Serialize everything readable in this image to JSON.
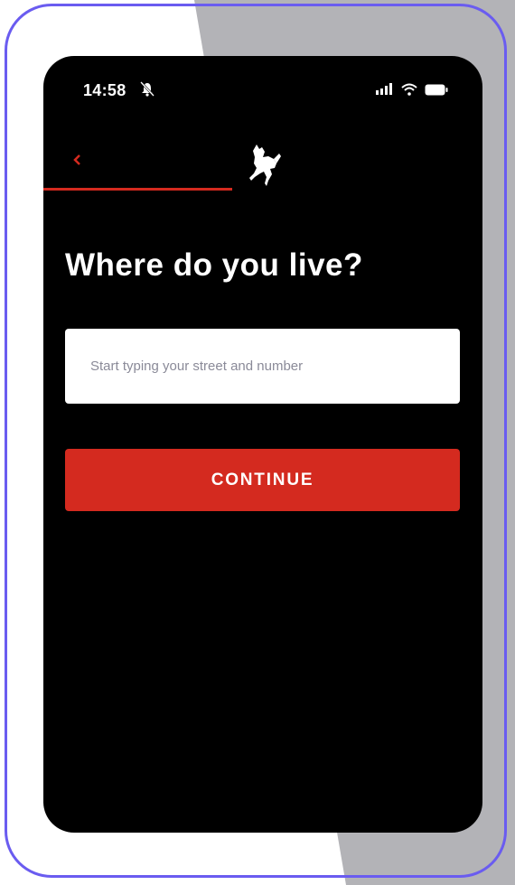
{
  "status_bar": {
    "time": "14:58",
    "icons": [
      "bell-slash-icon",
      "signal-icon",
      "wifi-icon",
      "battery-icon"
    ]
  },
  "nav": {
    "back_icon": "chevron-left-icon",
    "logo_icon": "prancing-horse-logo-icon",
    "progress": 0.43
  },
  "main": {
    "title": "Where do you live?",
    "address_placeholder": "Start typing your street and number",
    "address_value": "",
    "continue_label": "CONTINUE"
  },
  "colors": {
    "accent": "#d42a1f",
    "frame": "#6a5cf0",
    "screen_background": "#000000",
    "side_shape": "#b3b3b7"
  }
}
